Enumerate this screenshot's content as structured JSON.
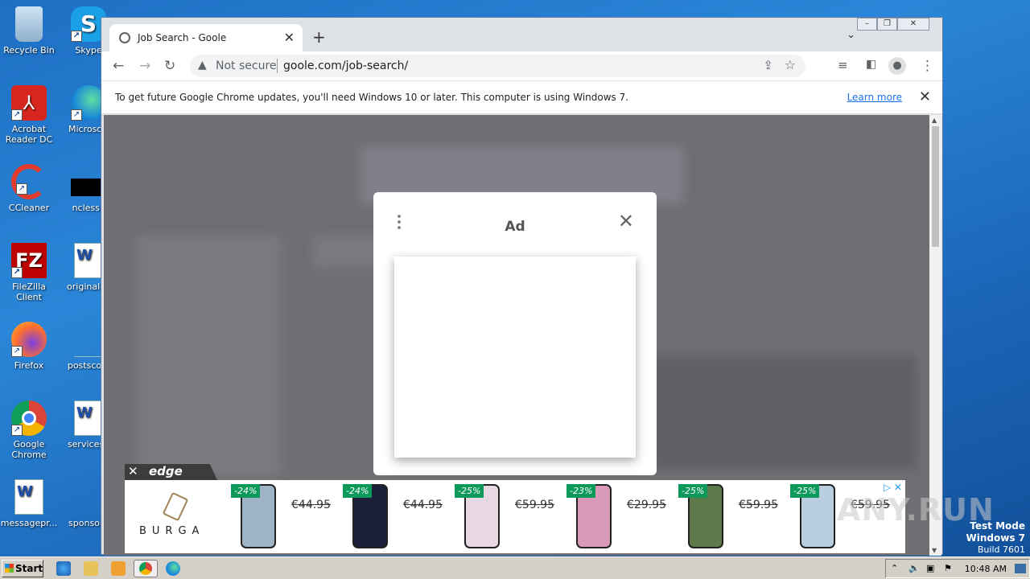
{
  "desktop": {
    "icons": [
      {
        "label": "Recycle Bin"
      },
      {
        "label": "Skype"
      },
      {
        "label": "Acrobat Reader DC"
      },
      {
        "label": "Microsoft"
      },
      {
        "label": "CCleaner"
      },
      {
        "label": "ncless.j"
      },
      {
        "label": "FileZilla Client"
      },
      {
        "label": "originalce"
      },
      {
        "label": "Firefox"
      },
      {
        "label": "postsconl"
      },
      {
        "label": "Google Chrome"
      },
      {
        "label": "servicesp"
      },
      {
        "label": "messagepr..."
      },
      {
        "label": "sponsore"
      }
    ]
  },
  "browser": {
    "tab_title": "Job Search - Goole",
    "omnibox": {
      "security": "Not secure",
      "url": "goole.com/job-search/"
    },
    "infobar": {
      "message": "To get future Google Chrome updates, you'll need Windows 10 or later. This computer is using Windows 7.",
      "link": "Learn more"
    }
  },
  "modal": {
    "title": "Ad"
  },
  "edge_ad": {
    "tab_label": "edge",
    "brand": "BURGA",
    "products": [
      {
        "discount": "-24%",
        "old_price": "€44.95",
        "case_color": "#9fb4c4"
      },
      {
        "discount": "-24%",
        "old_price": "€44.95",
        "case_color": "#1c1f3a"
      },
      {
        "discount": "-25%",
        "old_price": "€59.95",
        "case_color": "#e8d8e4"
      },
      {
        "discount": "-23%",
        "old_price": "€29.95",
        "case_color": "#d89ab8"
      },
      {
        "discount": "-25%",
        "old_price": "€59.95",
        "case_color": "#5f7a4a"
      },
      {
        "discount": "-25%",
        "old_price": "€59.95",
        "case_color": "#b8cde0"
      }
    ]
  },
  "watermark": {
    "text": "ANY.RUN",
    "mode_line1": "Test Mode",
    "mode_line2": "Windows 7",
    "mode_line3": "Build 7601"
  },
  "taskbar": {
    "start_label": "Start",
    "clock": "10:48 AM"
  }
}
